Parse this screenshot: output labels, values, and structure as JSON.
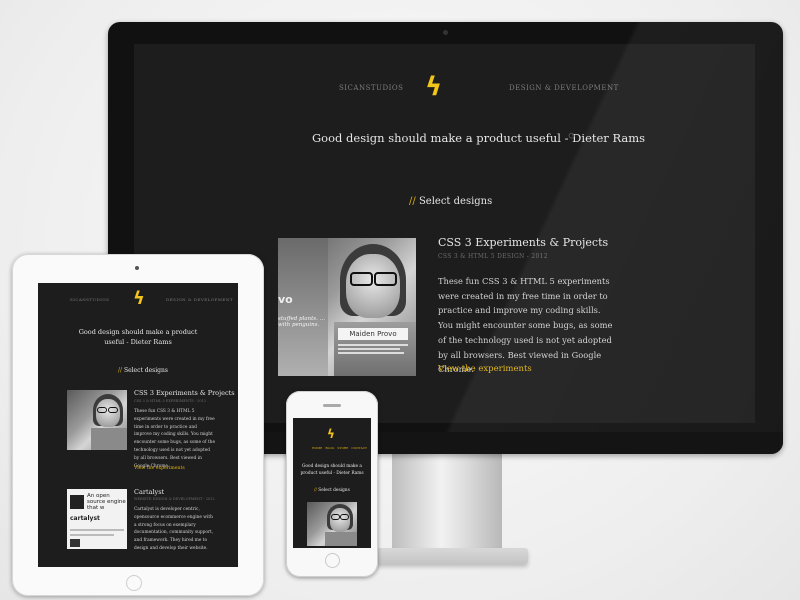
{
  "desktop": {
    "nav_left": "SICANSTUDIOS",
    "nav_right": "DESIGN & DEVELOPMENT",
    "logo_glyph": "ϟ",
    "tagline": "Good design should make a product useful - Dieter Rams",
    "refresh_glyph": "⟳",
    "section_slashes": "//",
    "section_title": "Select designs",
    "project": {
      "title": "CSS 3 Experiments & Projects",
      "meta": "CSS 3 & HTML 5 DESIGN - 2012",
      "description": "These fun CSS 3 & HTML 5 experiments were created in my free time in order to practice and improve my coding skills. You might encounter some bugs, as some of the technology used is not yet adopted by all browsers. Best viewed in Google Chrome.",
      "link": "View the experiments",
      "thumb_name": "Maiden Provo",
      "thumb_side_text": "vo",
      "thumb_script_text": "stuffed plants. …with penguins."
    }
  },
  "tablet": {
    "nav_left": "SICANSTUDIOS",
    "nav_right": "DESIGN & DEVELOPMENT",
    "logo_glyph": "ϟ",
    "tagline": "Good design should make a product useful - Dieter Rams",
    "section_slashes": "//",
    "section_title": "Select designs",
    "project1": {
      "title": "CSS 3 Experiments & Projects",
      "meta": "CSS 3 & HTML 5 EXPERIMENTS - 2012",
      "description": "These fun CSS 3 & HTML 5 experiments were created in my free time in order to practice and improve my coding skills. You might encounter some bugs, as some of the technology used is not yet adopted by all browsers. Best viewed in Google Chrome.",
      "link": "View the experiments"
    },
    "project2": {
      "title": "Cartalyst",
      "meta": "WEBSITE DESIGN & DEVELOPMENT - 2012",
      "description": "Cartalyst is developer centric, opensource ecommerce engine with a strong focus on exemplary documentation, community support, and framework. They hired me to design and develop their website.",
      "thumb_heading": "An open source engine that w",
      "thumb_brand": "cartalyst"
    }
  },
  "phone": {
    "logo_glyph": "ϟ",
    "nav_items": [
      "HOME",
      "BLOG",
      "STORE",
      "CONTACT"
    ],
    "tagline": "Good design should make a product useful - Dieter Rams",
    "section_slashes": "//",
    "section_title": "Select designs"
  },
  "colors": {
    "accent": "#e1b313",
    "screen_bg": "#1d1d1d"
  }
}
